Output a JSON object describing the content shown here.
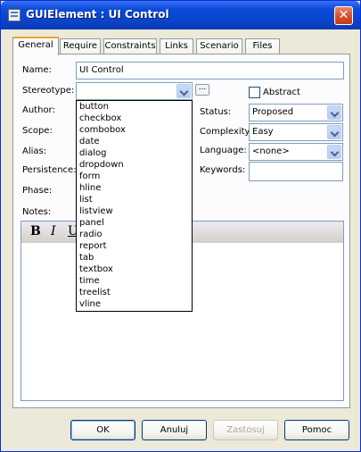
{
  "window": {
    "title": "GUIElement : UI Control"
  },
  "tabs": [
    "General",
    "Require",
    "Constraints",
    "Links",
    "Scenario",
    "Files"
  ],
  "form": {
    "name_label": "Name:",
    "name_value": "UI Control",
    "stereotype_label": "Stereotype:",
    "stereotype_value": "",
    "ellipsis": "...",
    "author_label": "Author:",
    "scope_label": "Scope:",
    "alias_label": "Alias:",
    "persistence_label": "Persistence:",
    "phase_label": "Phase:",
    "notes_label": "Notes:",
    "abstract_label": "Abstract",
    "abstract_checked": false,
    "status_label": "Status:",
    "status_value": "Proposed",
    "complexity_label": "Complexity:",
    "complexity_value": "Easy",
    "language_label": "Language:",
    "language_value": "<none>",
    "keywords_label": "Keywords:",
    "keywords_value": ""
  },
  "notes_toolbar": {
    "bold": "B",
    "italic": "I",
    "underline": "U"
  },
  "stereotype_options": [
    "button",
    "checkbox",
    "combobox",
    "date",
    "dialog",
    "dropdown",
    "form",
    "hline",
    "list",
    "listview",
    "panel",
    "radio",
    "report",
    "tab",
    "textbox",
    "time",
    "treelist",
    "vline"
  ],
  "buttons": {
    "ok": "OK",
    "cancel": "Anuluj",
    "apply": "Zastosuj",
    "help": "Pomoc"
  },
  "colors": {
    "title_bar": "#0a4bd9",
    "dialog_bg": "#ece9d8",
    "active_tab_accent": "#f1a330"
  }
}
